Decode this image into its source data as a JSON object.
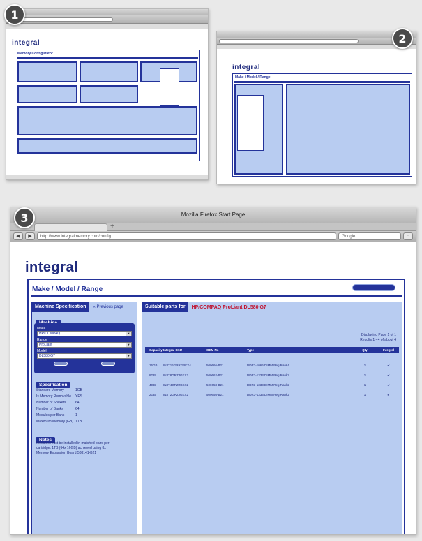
{
  "steps": [
    "1",
    "2",
    "3"
  ],
  "browser": {
    "window_title": "Mozilla Firefox Start Page",
    "url": "http://www.integralmemory.com/config",
    "search_placeholder": "Google"
  },
  "site": {
    "logo": "integral",
    "shot1_heading": "Memory Configurator",
    "page_heading": "Make / Model / Range"
  },
  "left_panel": {
    "title": "Machine Specification",
    "previous_link": "« Previous page",
    "machine_title": "Machine",
    "make_label": "Make",
    "make_value": "HP/COMPAQ",
    "range_label": "Range",
    "range_value": "ProLiant",
    "model_label": "Model",
    "model_value": "DL580 G7",
    "spec_title": "Specification",
    "specs": [
      {
        "k": "Standard Memory",
        "v": "1GB"
      },
      {
        "k": "Is Memory Removable",
        "v": "YES"
      },
      {
        "k": "Number of Sockets",
        "v": "64"
      },
      {
        "k": "Number of Banks",
        "v": "64"
      },
      {
        "k": "Modules per Bank",
        "v": "1"
      },
      {
        "k": "Maximum Memory (GB)",
        "v": "1TB"
      }
    ],
    "notes_title": "Notes",
    "notes_text": "Modules must be installed in matched pairs per cartridge. 1TB (64x 16GB) achieved using 8x Memory Expansion Board 588141-B21"
  },
  "right_panel": {
    "title": "Suitable parts for",
    "selection": "HP/COMPAQ ProLiant DL580 G7",
    "paging_line1": "Displaying Page 1 of 1",
    "paging_line2": "Results 1 - 4 of about 4",
    "columns": [
      "Capacity",
      "Integral SKU",
      "OEM No",
      "Type",
      "Qty",
      "Integral"
    ],
    "rows": [
      {
        "cap": "16GB",
        "sku": "IN3T16GRRGBKX4",
        "oem": "500666-B21",
        "type": "DDR3-1066 DIMM Reg Rank4",
        "qty": "1"
      },
      {
        "cap": "8GB",
        "sku": "IN3T8GRZJGKX2",
        "oem": "500662-B21",
        "type": "DDR3-1333 DIMM Reg Rank2",
        "qty": "1"
      },
      {
        "cap": "4GB",
        "sku": "IN3T4GRZJGKX2",
        "oem": "500658-B21",
        "type": "DDR3-1333 DIMM Reg Rank2",
        "qty": "1"
      },
      {
        "cap": "2GB",
        "sku": "IN3T2GRZJGKX2",
        "oem": "500656-B21",
        "type": "DDR3-1333 DIMM Reg Rank2",
        "qty": "1"
      }
    ]
  },
  "colors": {
    "navy": "#24339a",
    "panel": "#b8ccf1",
    "accent_red": "#c0122e"
  }
}
